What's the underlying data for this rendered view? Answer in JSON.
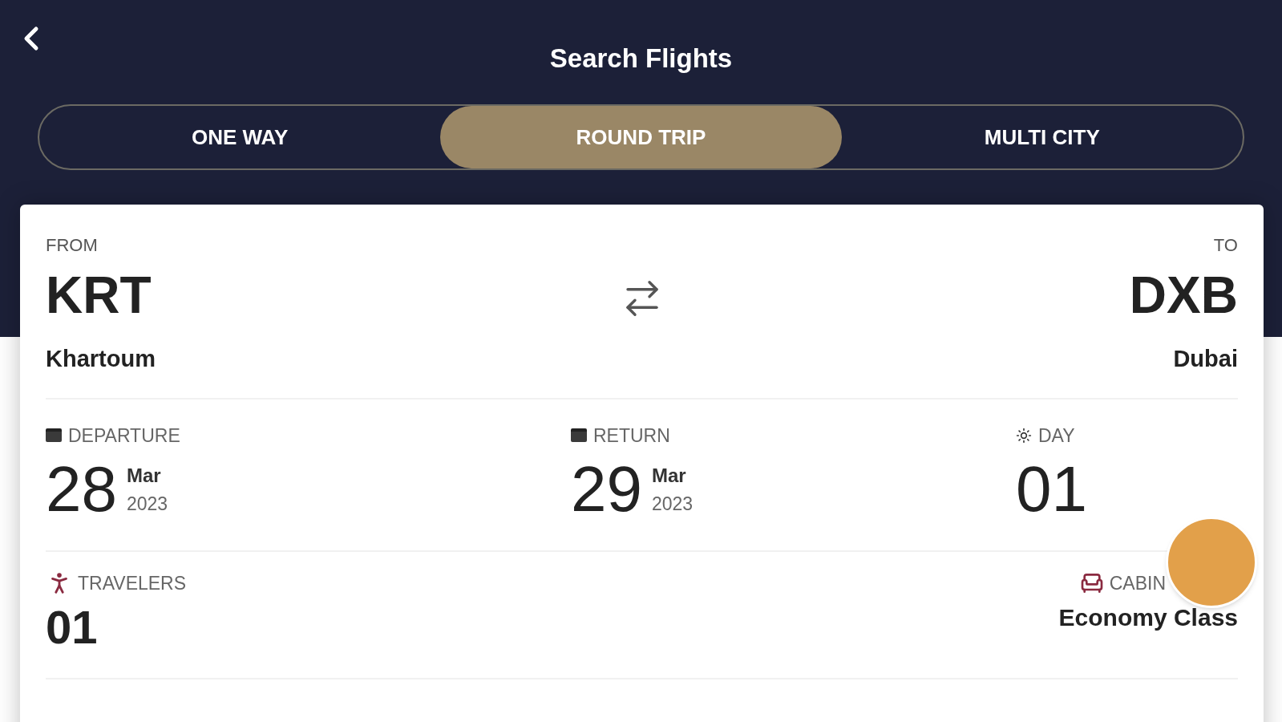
{
  "header": {
    "title": "Search Flights"
  },
  "tabs": [
    {
      "label": "ONE WAY",
      "selected": false
    },
    {
      "label": "ROUND TRIP",
      "selected": true
    },
    {
      "label": "MULTI CITY",
      "selected": false
    }
  ],
  "route": {
    "from_label": "FROM",
    "from_code": "KRT",
    "from_city": "Khartoum",
    "to_label": "TO",
    "to_code": "DXB",
    "to_city": "Dubai"
  },
  "dates": [
    {
      "kind": "date",
      "label": "DEPARTURE",
      "day": "28",
      "month": "Mar",
      "year": "2023"
    },
    {
      "kind": "date",
      "label": "RETURN",
      "day": "29",
      "month": "Mar",
      "year": "2023"
    },
    {
      "kind": "days",
      "label": "DAY",
      "day": "01"
    }
  ],
  "travelers": {
    "label": "TRAVELERS",
    "value": "01"
  },
  "cabin": {
    "label": "CABIN",
    "value": "Economy Class"
  }
}
